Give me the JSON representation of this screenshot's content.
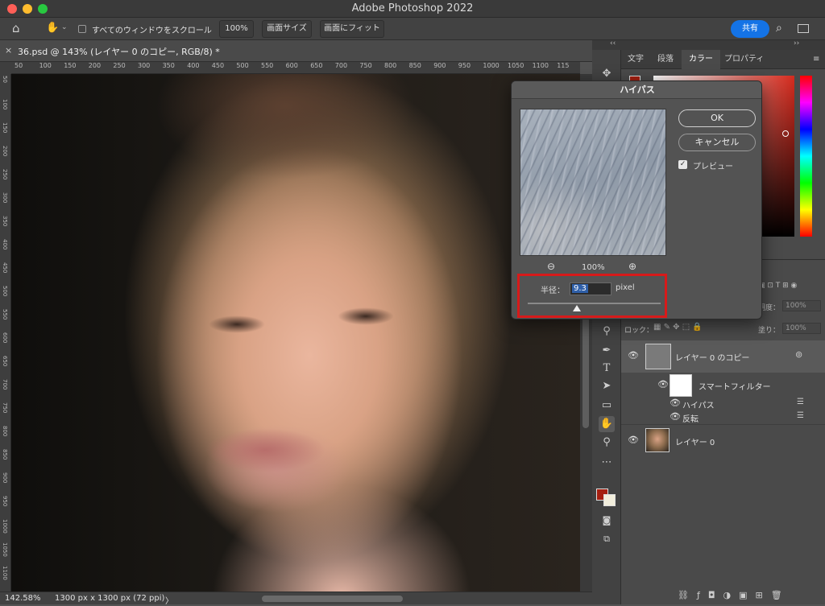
{
  "app": {
    "title": "Adobe Photoshop 2022"
  },
  "options": {
    "scroll_all_label": "すべてのウィンドウをスクロール",
    "zoom100_label": "100%",
    "screen_size_label": "画面サイズ",
    "fit_screen_label": "画面にフィット",
    "share_label": "共有"
  },
  "document": {
    "tab_title": "36.psd @ 143% (レイヤー 0 のコピー, RGB/8) *",
    "ruler_h_ticks": [
      "50",
      "100",
      "150",
      "200",
      "250",
      "300",
      "350",
      "400",
      "450",
      "500",
      "550",
      "600",
      "650",
      "700",
      "750",
      "800",
      "850",
      "900",
      "950",
      "1000",
      "1050",
      "1100",
      "115"
    ],
    "ruler_v_ticks": [
      "50",
      "100",
      "150",
      "200",
      "250",
      "300",
      "350",
      "400",
      "450",
      "500",
      "550",
      "600",
      "650",
      "700",
      "750",
      "800",
      "850",
      "900",
      "950",
      "1000",
      "1050",
      "1100"
    ]
  },
  "status": {
    "zoom": "142.58%",
    "doc_size": "1300 px x 1300 px (72 ppi)",
    "arrow": "〉"
  },
  "panels": {
    "tabs": [
      "文字",
      "段落",
      "カラー",
      "プロパティ"
    ],
    "opacity_label": "明度：",
    "opacity_value": "100%",
    "lock_label": "ロック：",
    "fill_label": "塗り：",
    "fill_value": "100%"
  },
  "layers": [
    {
      "name": "レイヤー 0 のコピー"
    },
    {
      "name": "スマートフィルター"
    },
    {
      "name": "ハイパス"
    },
    {
      "name": "反転"
    },
    {
      "name": "レイヤー 0"
    }
  ],
  "dialog": {
    "title": "ハイパス",
    "zoom_value": "100%",
    "ok_label": "OK",
    "cancel_label": "キャンセル",
    "preview_label": "プレビュー",
    "preview_checked": true,
    "radius_label": "半径：",
    "radius_value": "9.3",
    "radius_unit": "pixel",
    "radius_slider_fraction": 0.37
  },
  "colors": {
    "accent": "#1473e6",
    "highlight_box": "#d71a1a",
    "foreground_swatch": "#a51f10",
    "background_swatch": "#f2eedc"
  }
}
